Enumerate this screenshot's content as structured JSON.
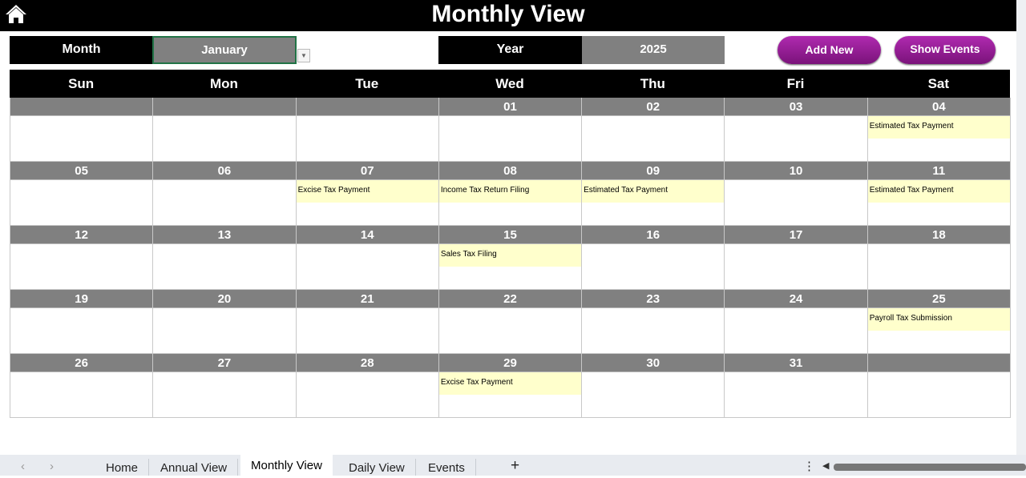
{
  "header": {
    "title": "Monthly View",
    "home_icon": "home-icon"
  },
  "controls": {
    "month_label": "Month",
    "month_value": "January",
    "year_label": "Year",
    "year_value": "2025",
    "add_new": "Add New",
    "show_events": "Show Events"
  },
  "weekdays": [
    "Sun",
    "Mon",
    "Tue",
    "Wed",
    "Thu",
    "Fri",
    "Sat"
  ],
  "weeks": [
    [
      {
        "d": "",
        "e": ""
      },
      {
        "d": "",
        "e": ""
      },
      {
        "d": "",
        "e": ""
      },
      {
        "d": "01",
        "e": ""
      },
      {
        "d": "02",
        "e": ""
      },
      {
        "d": "03",
        "e": ""
      },
      {
        "d": "04",
        "e": "Estimated Tax Payment"
      }
    ],
    [
      {
        "d": "05",
        "e": ""
      },
      {
        "d": "06",
        "e": ""
      },
      {
        "d": "07",
        "e": "Excise Tax Payment"
      },
      {
        "d": "08",
        "e": "Income Tax Return Filing"
      },
      {
        "d": "09",
        "e": "Estimated Tax Payment"
      },
      {
        "d": "10",
        "e": ""
      },
      {
        "d": "11",
        "e": "Estimated Tax Payment"
      }
    ],
    [
      {
        "d": "12",
        "e": ""
      },
      {
        "d": "13",
        "e": ""
      },
      {
        "d": "14",
        "e": ""
      },
      {
        "d": "15",
        "e": "Sales Tax Filing"
      },
      {
        "d": "16",
        "e": ""
      },
      {
        "d": "17",
        "e": ""
      },
      {
        "d": "18",
        "e": ""
      }
    ],
    [
      {
        "d": "19",
        "e": ""
      },
      {
        "d": "20",
        "e": ""
      },
      {
        "d": "21",
        "e": ""
      },
      {
        "d": "22",
        "e": ""
      },
      {
        "d": "23",
        "e": ""
      },
      {
        "d": "24",
        "e": ""
      },
      {
        "d": "25",
        "e": "Payroll Tax Submission"
      }
    ],
    [
      {
        "d": "26",
        "e": ""
      },
      {
        "d": "27",
        "e": ""
      },
      {
        "d": "28",
        "e": ""
      },
      {
        "d": "29",
        "e": "Excise Tax Payment"
      },
      {
        "d": "30",
        "e": ""
      },
      {
        "d": "31",
        "e": ""
      },
      {
        "d": "",
        "e": ""
      }
    ]
  ],
  "sheet_tabs": [
    "Home",
    "Annual View",
    "Monthly View",
    "Daily View",
    "Events"
  ],
  "active_tab": "Monthly View",
  "colors": {
    "header": "#000000",
    "date_row": "#808080",
    "event": "#ffffcc",
    "button": "#9c1f9c"
  }
}
